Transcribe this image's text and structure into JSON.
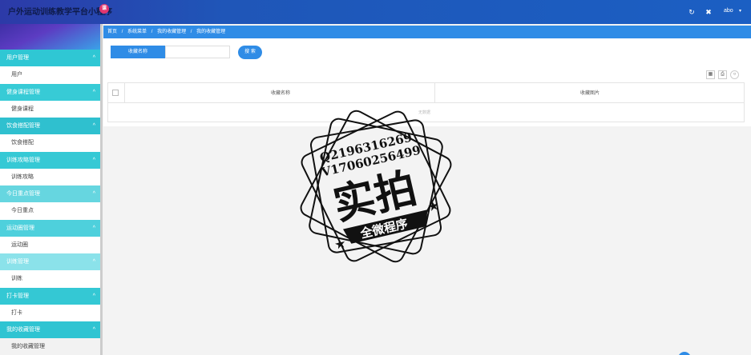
{
  "header": {
    "title": "户外运动训练教学平台小程序",
    "badge": "课",
    "user": "abo",
    "caret": "▾",
    "icons": [
      "refresh-icon",
      "fullscreen-icon"
    ]
  },
  "sidebar": {
    "groups": [
      {
        "label": "用户管理",
        "item": "用户",
        "color": "#2fc7d4"
      },
      {
        "label": "健身课程管理",
        "item": "健身课程",
        "color": "#37cbd6"
      },
      {
        "label": "饮食搭配管理",
        "item": "饮食搭配",
        "color": "#2fc0cf"
      },
      {
        "label": "训练攻略管理",
        "item": "训练攻略",
        "color": "#36c9d5"
      },
      {
        "label": "今日重点管理",
        "item": "今日重点",
        "color": "#66d6e0"
      },
      {
        "label": "运动圈管理",
        "item": "运动圈",
        "color": "#4ed0dc"
      },
      {
        "label": "训练管理",
        "item": "训练",
        "color": "#8be2ea"
      },
      {
        "label": "打卡管理",
        "item": "打卡",
        "color": "#34c8d4"
      },
      {
        "label": "我的收藏管理",
        "item": "我的收藏管理",
        "color": "#2fc4d2"
      }
    ]
  },
  "breadcrumb": [
    "首页",
    "/",
    "系统菜单",
    "/",
    "我的收藏管理",
    "/",
    "我的收藏管理"
  ],
  "search": {
    "label": "收藏名称",
    "placeholder": "",
    "button": "搜 索"
  },
  "table": {
    "columns": [
      "收藏名称",
      "收藏图片"
    ],
    "empty_text": "无数据"
  },
  "watermark": {
    "line1": "Q2196316269",
    "line2": "V17060256499",
    "big": "实拍",
    "banner": "全微程序"
  }
}
